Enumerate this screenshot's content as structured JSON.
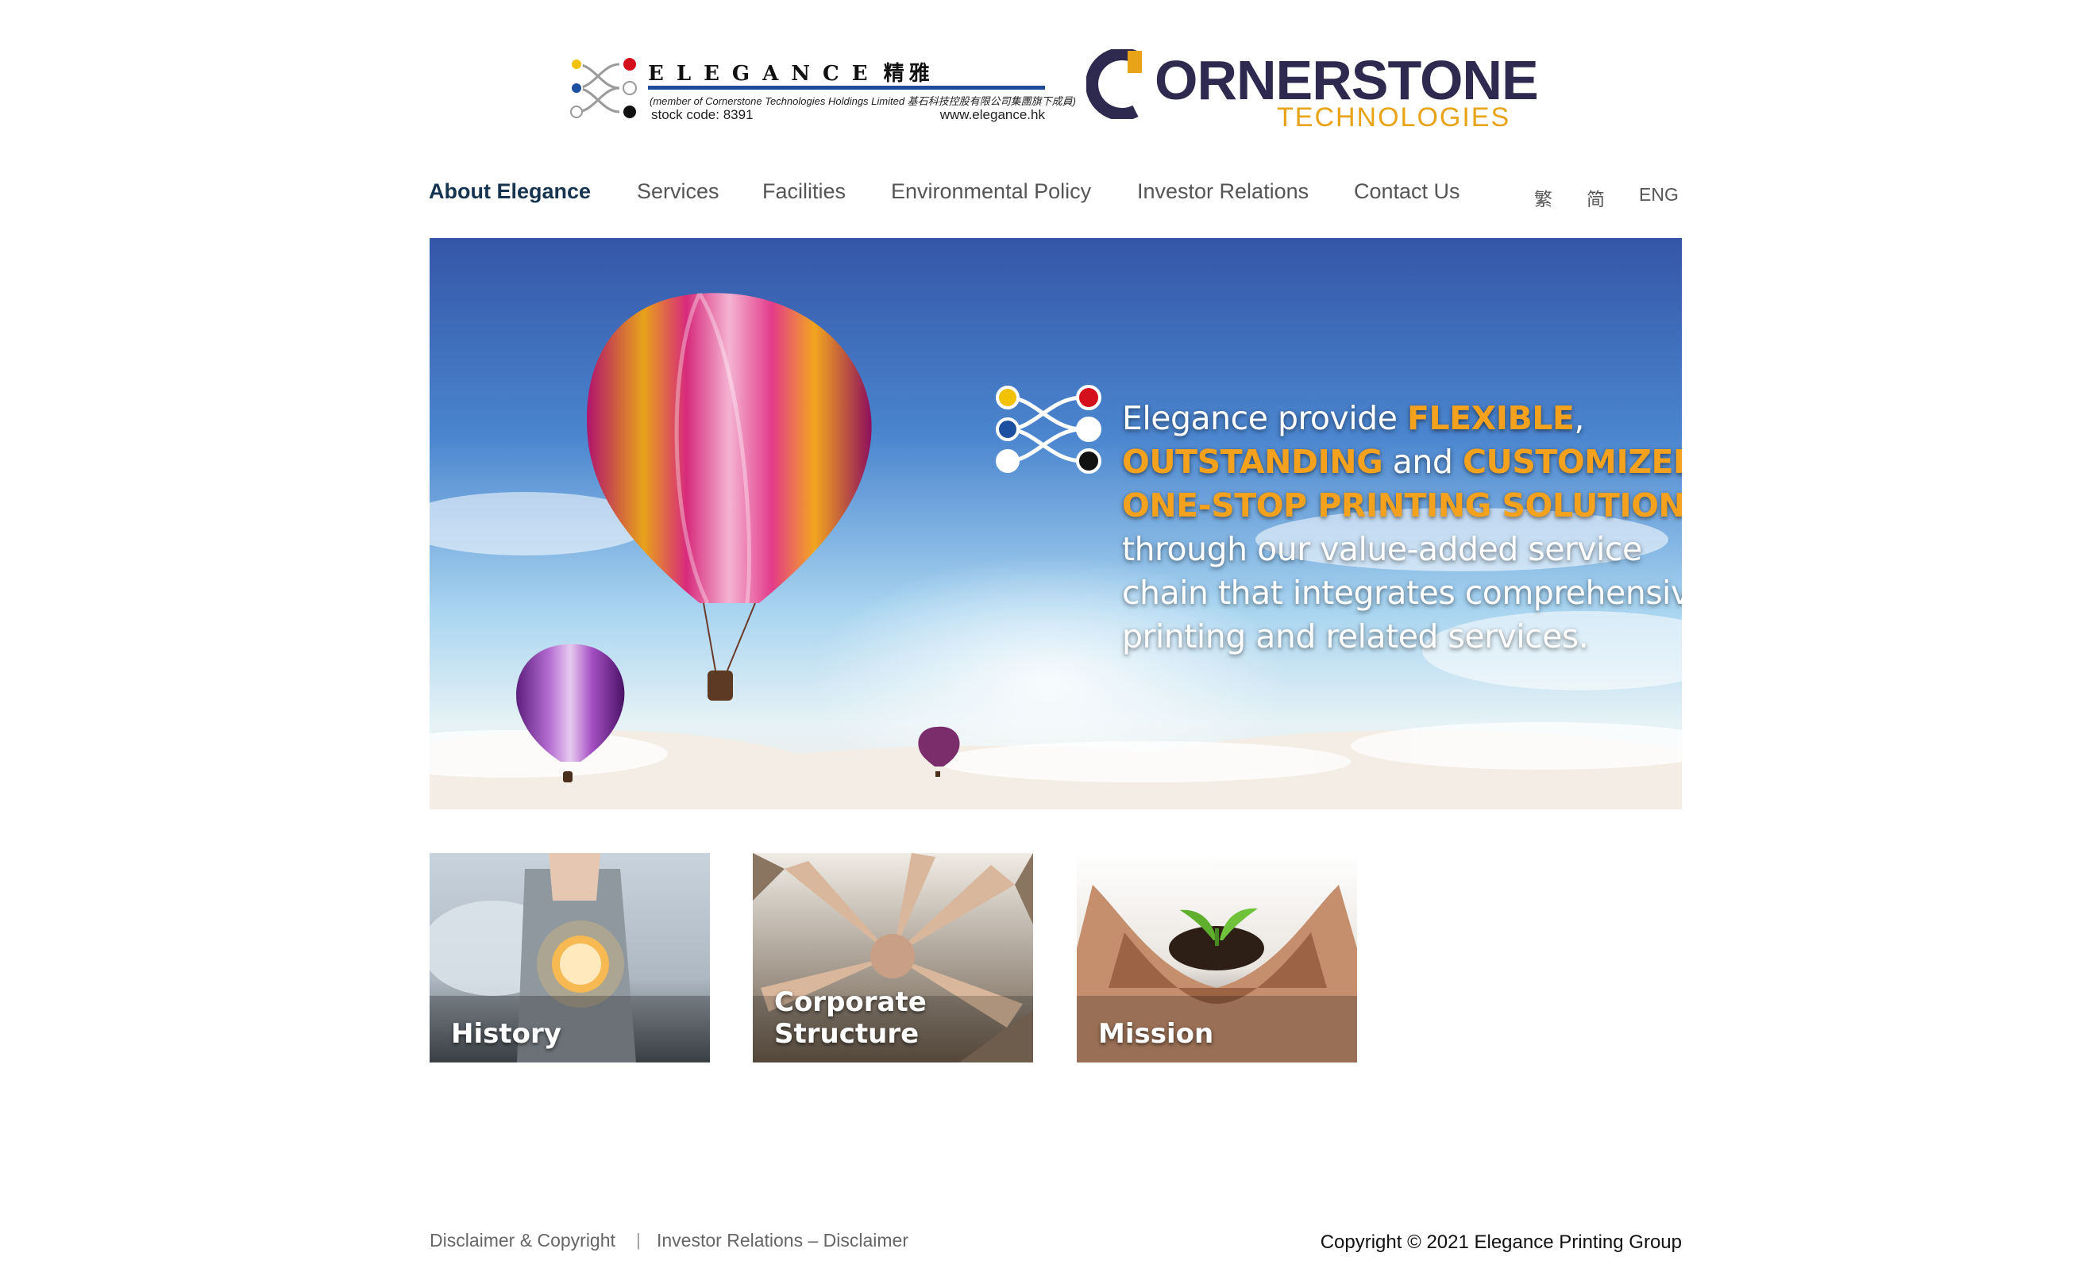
{
  "header": {
    "elegance_logo": {
      "wordmark": "ELEGANCE",
      "chinese": "精雅",
      "member_line": "(member of Cornerstone Technologies Holdings Limited 基石科技控股有限公司集團旗下成員)",
      "stock_code": "stock code: 8391",
      "url": "www.elegance.hk"
    },
    "cornerstone_logo": {
      "wordmark": "ORNERSTONE",
      "sub": "TECHNOLOGIES",
      "brand_color": "#2e2a4f",
      "accent_color": "#e8a317"
    }
  },
  "nav": {
    "items": [
      {
        "label": "About Elegance",
        "active": true
      },
      {
        "label": "Services",
        "active": false
      },
      {
        "label": "Facilities",
        "active": false
      },
      {
        "label": "Environmental Policy",
        "active": false
      },
      {
        "label": "Investor Relations",
        "active": false
      },
      {
        "label": "Contact Us",
        "active": false
      }
    ],
    "languages": [
      "繁",
      "简",
      "ENG"
    ]
  },
  "hero": {
    "lines": [
      {
        "parts": [
          "Elegance provide ",
          "FLEXIBLE",
          ","
        ]
      },
      {
        "parts": [
          "OUTSTANDING",
          " and ",
          "CUSTOMIZED"
        ]
      },
      {
        "parts": [
          "ONE-STOP PRINTING SOLUTIONS"
        ]
      },
      {
        "parts": [
          "through our value-added service"
        ]
      },
      {
        "parts": [
          "chain that integrates comprehensive"
        ]
      },
      {
        "parts": [
          "printing and related services."
        ]
      }
    ],
    "highlight_color": "#f4a11e"
  },
  "tiles": [
    {
      "label": "History"
    },
    {
      "label": "Corporate\nStructure"
    },
    {
      "label": "Mission"
    }
  ],
  "footer": {
    "links": [
      "Disclaimer & Copyright",
      "Investor Relations – Disclaimer"
    ],
    "separator": "|",
    "copyright": "Copyright © 2021 Elegance Printing Group"
  }
}
